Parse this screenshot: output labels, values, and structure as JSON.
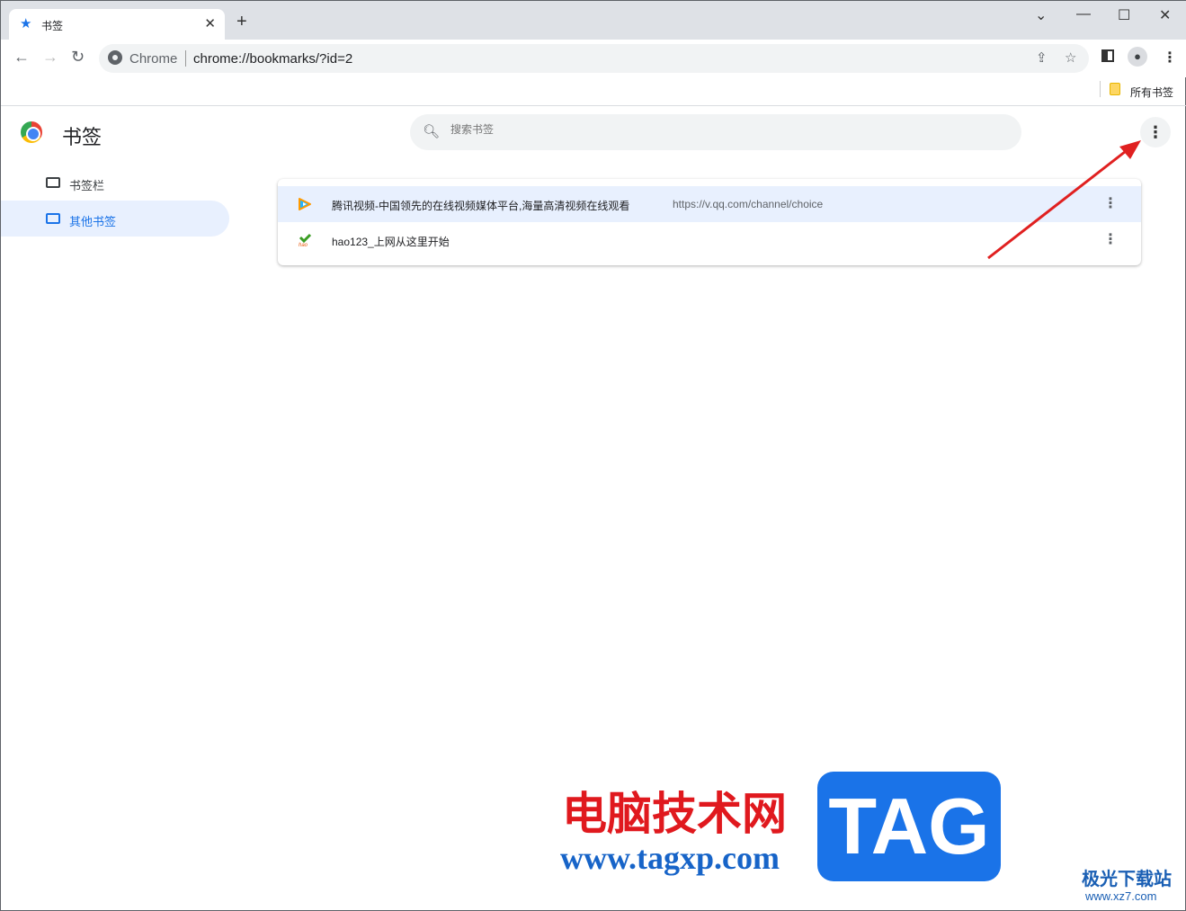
{
  "tab": {
    "title": "书签",
    "icon": "star-icon"
  },
  "address": {
    "site_label": "Chrome",
    "url": "chrome://bookmarks/?id=2"
  },
  "bookmarks_bar": {
    "all_bookmarks": "所有书签"
  },
  "page": {
    "title": "书签",
    "search_placeholder": "搜索书签"
  },
  "sidebar": {
    "items": [
      {
        "label": "书签栏",
        "selected": false
      },
      {
        "label": "其他书签",
        "selected": true
      }
    ]
  },
  "list": [
    {
      "name": "腾讯视频-中国领先的在线视频媒体平台,海量高清视频在线观看",
      "url": "https://v.qq.com/channel/choice",
      "highlighted": true
    },
    {
      "name": "hao123_上网从这里开始",
      "url": ""
    }
  ],
  "watermark": {
    "text": "电脑技术网",
    "url": "www.tagxp.com",
    "badge": "TAG",
    "site": "极光下载站",
    "site_url": "www.xz7.com"
  },
  "colors": {
    "accent": "#1a73e8",
    "selected_bg": "#e8f0fe",
    "arrow": "#e02020"
  }
}
